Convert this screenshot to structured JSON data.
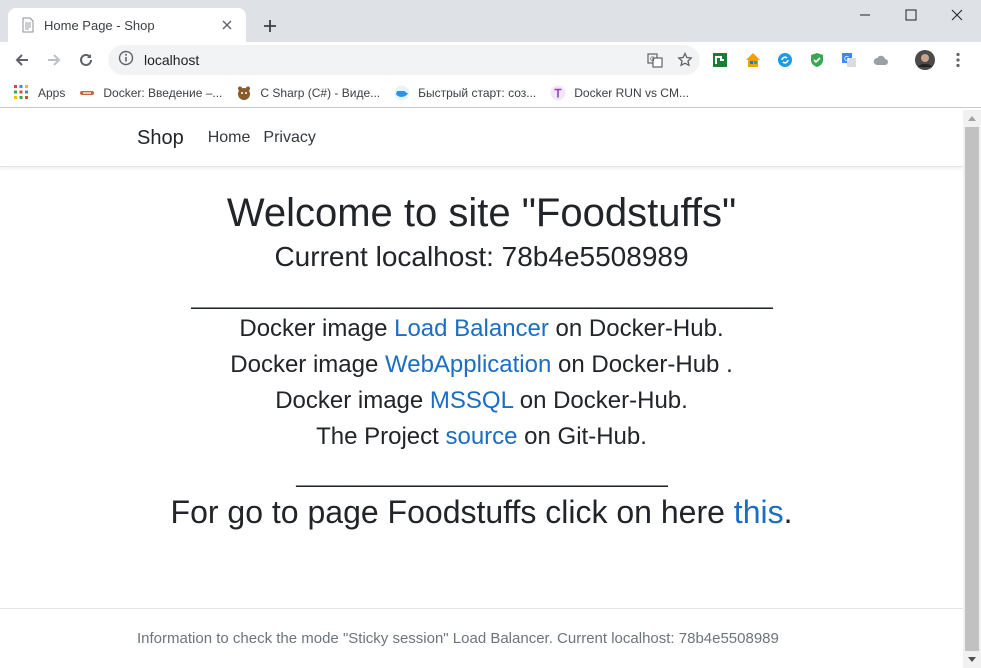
{
  "browser": {
    "tab_title": "Home Page - Shop",
    "url": "localhost",
    "bookmarks": [
      {
        "label": "Apps",
        "icon": "apps-grid-icon"
      },
      {
        "label": "Docker: Введение –...",
        "icon": "docker-site-icon"
      },
      {
        "label": "C Sharp (C#) - Виде...",
        "icon": "csharp-site-icon"
      },
      {
        "label": "Быстрый старт: соз...",
        "icon": "docker-whale-icon"
      },
      {
        "label": "Docker RUN vs CM...",
        "icon": "t-letter-icon"
      }
    ],
    "colors": {
      "tabstrip": "#dee1e6",
      "omnibox": "#f1f3f4"
    }
  },
  "site": {
    "brand": "Shop",
    "nav": [
      "Home",
      "Privacy"
    ],
    "heading": "Welcome to site \"Foodstuffs\"",
    "subheading": "Current localhost: 78b4e5508989",
    "rule1": "_______________________________________________",
    "lines": [
      {
        "pre": "Docker image ",
        "link": "Load Balancer",
        "post": " on Docker-Hub."
      },
      {
        "pre": "Docker image ",
        "link": "WebApplication",
        "post": " on Docker-Hub ."
      },
      {
        "pre": "Docker image ",
        "link": "MSSQL",
        "post": " on Docker-Hub."
      },
      {
        "pre": "The Project ",
        "link": "source",
        "post": " on Git-Hub."
      }
    ],
    "rule2": "______________________________",
    "goto": {
      "pre": "For go to page Foodstuffs click on here ",
      "link": "this",
      "post": "."
    },
    "footer": "Information to check the mode \"Sticky session\" Load Balancer. Current localhost: 78b4e5508989",
    "colors": {
      "link": "#1b6ec2",
      "text": "#212529",
      "footer_text": "#6c757d"
    }
  }
}
